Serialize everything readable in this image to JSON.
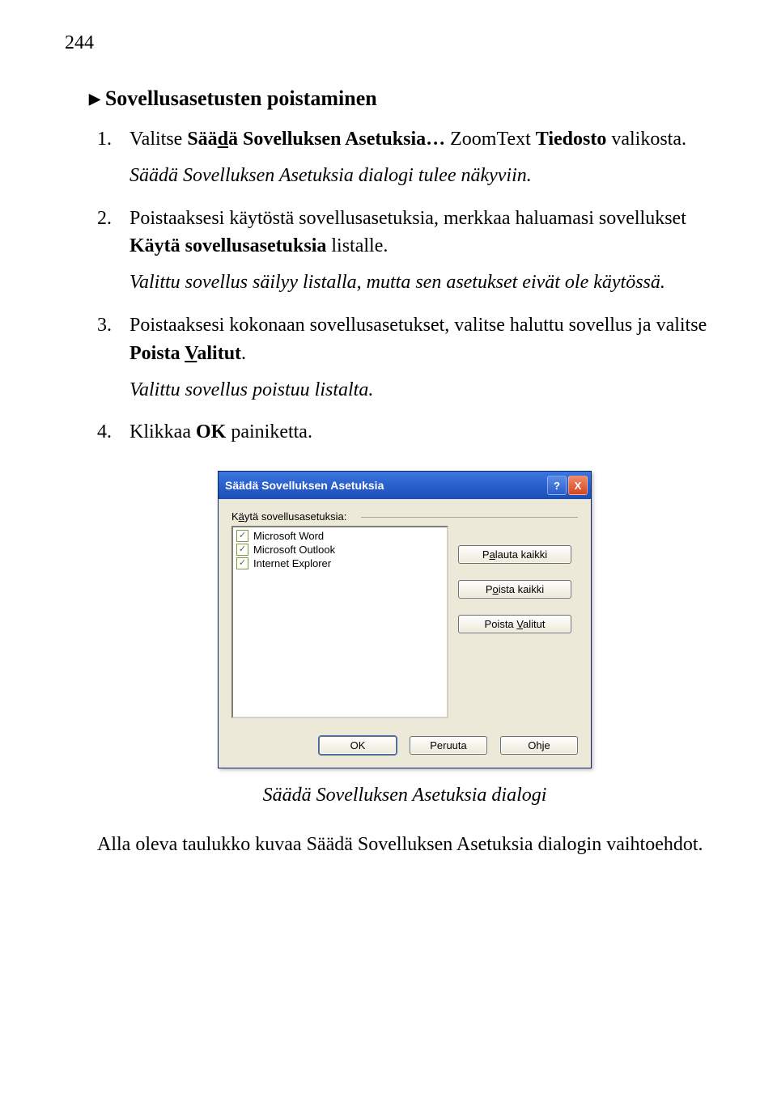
{
  "page_number": "244",
  "heading": {
    "triangle": "▶",
    "text": "Sovellusasetusten poistaminen"
  },
  "steps": {
    "s1": {
      "pre": "Valitse ",
      "bold_pre": "Sää",
      "bold_u": "d",
      "bold_post": "ä Sovelluksen Asetuksia…",
      "post1": " ZoomText ",
      "bold2": "Tiedosto",
      "post2": " valikosta.",
      "note": "Säädä Sovelluksen Asetuksia dialogi tulee näkyviin."
    },
    "s2": {
      "pre": "Poistaaksesi käytöstä sovellusasetuksia, merkkaa haluamasi sovellukset ",
      "bold": "Käytä sovellusasetuksia",
      "post": " listalle.",
      "note": "Valittu sovellus säilyy listalla, mutta sen asetukset eivät ole käytössä."
    },
    "s3": {
      "pre": "Poistaaksesi kokonaan sovellusasetukset, valitse haluttu sovellus ja valitse ",
      "bold_pre": "Poista ",
      "bold_u": "V",
      "bold_post": "alitut",
      "post": ".",
      "note": "Valittu sovellus poistuu listalta."
    },
    "s4": {
      "pre": "Klikkaa ",
      "bold": "OK",
      "post": " painiketta."
    }
  },
  "dialog": {
    "title": "Säädä Sovelluksen Asetuksia",
    "help": "?",
    "close": "X",
    "group_label_pre": "K",
    "group_label_u": "ä",
    "group_label_post": "ytä sovellusasetuksia:",
    "items": [
      {
        "label": "Microsoft Word",
        "checked": true
      },
      {
        "label": "Microsoft Outlook",
        "checked": true
      },
      {
        "label": "Internet Explorer",
        "checked": true
      }
    ],
    "buttons": {
      "restore_pre": "P",
      "restore_u": "a",
      "restore_post": "lauta kaikki",
      "removeall_pre": "P",
      "removeall_u": "o",
      "removeall_post": "ista kaikki",
      "removesel_pre": "Poista ",
      "removesel_u": "V",
      "removesel_post": "alitut",
      "ok": "OK",
      "cancel": "Peruuta",
      "help_btn": "Ohje"
    }
  },
  "caption": "Säädä Sovelluksen Asetuksia dialogi",
  "closing": "Alla oleva taulukko kuvaa Säädä Sovelluksen Asetuksia dialogin vaihtoehdot."
}
